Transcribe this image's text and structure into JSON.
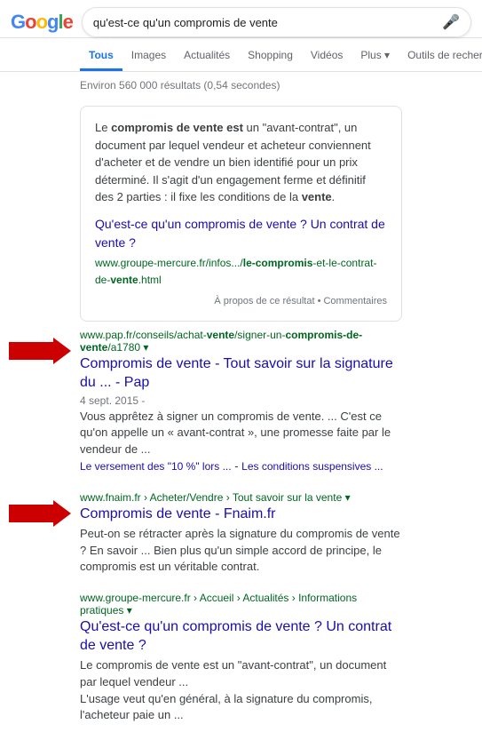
{
  "header": {
    "logo": "Google",
    "search_query": "qu'est-ce qu'un compromis de vente",
    "mic_icon": "🎤"
  },
  "nav": {
    "tabs": [
      {
        "label": "Tous",
        "active": true
      },
      {
        "label": "Images",
        "active": false
      },
      {
        "label": "Actualités",
        "active": false
      },
      {
        "label": "Shopping",
        "active": false
      },
      {
        "label": "Vidéos",
        "active": false
      },
      {
        "label": "Plus ▾",
        "active": false
      },
      {
        "label": "Outils de recherche",
        "active": false
      }
    ]
  },
  "results_count": "Environ 560 000 résultats (0,54 secondes)",
  "featured_snippet": {
    "text_parts": [
      {
        "type": "plain",
        "text": "Le "
      },
      {
        "type": "bold",
        "text": "compromis de vente est"
      },
      {
        "type": "plain",
        "text": " un \"avant-contrat\", un document par lequel vendeur et acheteur conviennent d'acheter et de vendre un bien identifié pour un prix déterminé. Il s'agit d'un engagement ferme et définitif des 2 parties : il fixe les conditions de la "
      },
      {
        "type": "bold",
        "text": "vente"
      },
      {
        "type": "plain",
        "text": "."
      }
    ],
    "link_title": "Qu'est-ce qu'un compromis de vente ? Un contrat de vente ?",
    "link_url_prefix": "www.groupe-mercure.fr/infos.../",
    "link_url_bold": "le-compromis",
    "link_url_suffix": "-et-le-contrat-de-",
    "link_url_bold2": "vente",
    "link_url_end": ".html",
    "footer": "À propos de ce résultat • Commentaires"
  },
  "results": [
    {
      "url_display": "www.pap.fr/conseils/achat-vente/signer-un-compromis-de-vente/a1780 ▾",
      "title_parts": [
        {
          "type": "plain",
          "text": "Compromis de vente - Tout savoir sur la signature du ... - Pap"
        }
      ],
      "meta": "4 sept. 2015 -",
      "desc": "Vous apprêtez à signer un compromis de vente. ... C'est ce qu'on appelle un « avant-contrat », une promesse faite par le vendeur de ...\nLe versement des \"10 %\" lors ... - Les conditions suspensives ...",
      "has_sublinks": true
    },
    {
      "url_display": "www.fnaim.fr › Acheter/Vendre › Tout savoir sur la vente ▾",
      "title_parts": [
        {
          "type": "plain",
          "text": "Compromis de vente - Fnaim.fr"
        }
      ],
      "meta": "",
      "desc": "Peut-on se rétracter après la signature du compromis de vente ? En savoir ... Bien plus qu'un simple accord de principe, le compromis est un véritable contrat.",
      "has_sublinks": false
    },
    {
      "url_display": "www.groupe-mercure.fr › Accueil › Actualités › Informations pratiques ▾",
      "title_parts": [
        {
          "type": "plain",
          "text": "Qu'est-ce qu'un compromis de vente ? Un contrat de vente ?"
        }
      ],
      "meta": "",
      "desc": "Le compromis de vente est un \"avant-contrat\", un document par lequel vendeur ...\nL'usage veut qu'en général, à la signature du compromis, l'acheteur paie un ...",
      "has_sublinks": false
    }
  ]
}
